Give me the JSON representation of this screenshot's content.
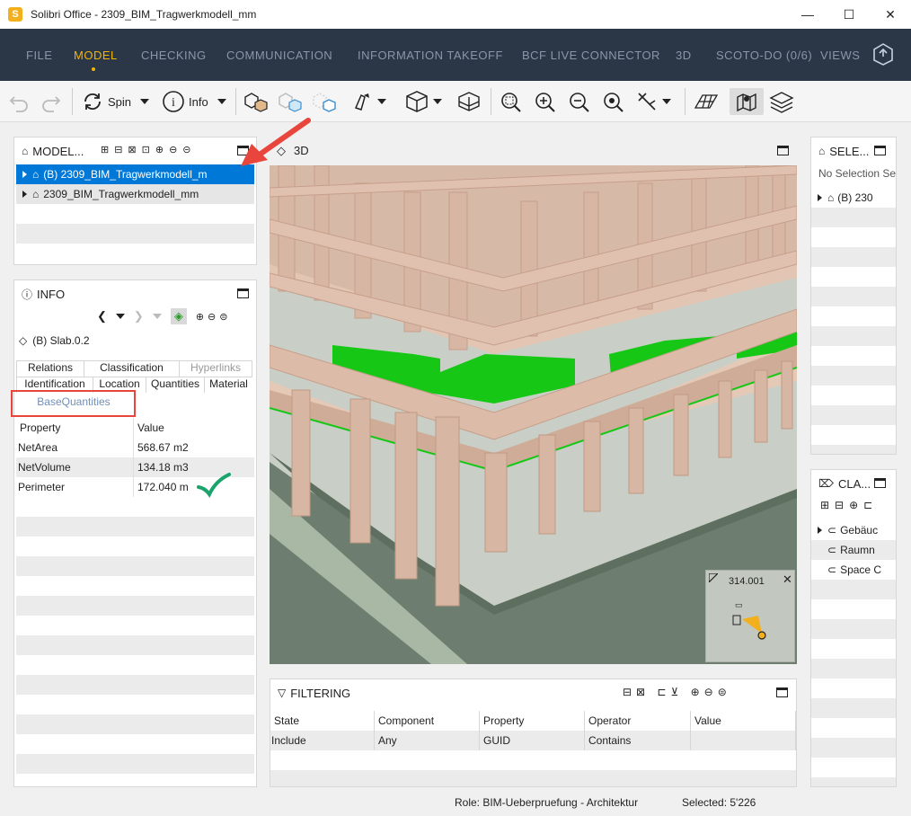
{
  "window": {
    "title": "Solibri Office - 2309_BIM_Tragwerkmodell_mm",
    "logo_letter": "S",
    "minimize": "—",
    "maximize": "☐",
    "close": "✕"
  },
  "menu": {
    "items": [
      "FILE",
      "MODEL",
      "CHECKING",
      "COMMUNICATION",
      "INFORMATION TAKEOFF",
      "BCF LIVE CONNECTOR",
      "3D",
      "SCOTO-DO (0/6)",
      "VIEWS"
    ],
    "active": "MODEL",
    "accent_color": "#f4b400"
  },
  "toolbar": {
    "spin_label": "Spin",
    "info_label": "Info"
  },
  "model_panel": {
    "title": "MODEL...",
    "rows": [
      "(B) 2309_BIM_Tragwerkmodell_m",
      "2309_BIM_Tragwerkmodell_mm"
    ]
  },
  "info_panel": {
    "title": "INFO",
    "object_name": "(B) Slab.0.2",
    "tabs_row1": [
      "Relations",
      "Classification",
      "Hyperlinks"
    ],
    "tabs_row2": [
      "Identification",
      "Location",
      "Quantities",
      "Material"
    ],
    "active_tab": "BaseQuantities",
    "headers": [
      "Property",
      "Value"
    ],
    "rows": [
      {
        "property": "NetArea",
        "value": "568.67 m2"
      },
      {
        "property": "NetVolume",
        "value": "134.18 m3"
      },
      {
        "property": "Perimeter",
        "value": "172.040 m"
      }
    ]
  },
  "view3d": {
    "title": "3D",
    "navigator_value": "314.001"
  },
  "selection_panel": {
    "title": "SELE...",
    "empty_text": "No Selection Se",
    "rows": [
      "(B) 230"
    ]
  },
  "classification_panel": {
    "title": "CLA...",
    "rows": [
      "Gebäuc",
      "Raumn",
      "Space C"
    ]
  },
  "filtering": {
    "title": "FILTERING",
    "headers": [
      "State",
      "Component",
      "Property",
      "Operator",
      "Value"
    ],
    "row": [
      "Include",
      "Any",
      "GUID",
      "Contains",
      ""
    ]
  },
  "status": {
    "role": "Role: BIM-Ueberpruefung - Architektur",
    "selected": "Selected: 5'226"
  },
  "colors": {
    "menubar": "#2b3647",
    "selection": "#0078d7",
    "annotation_red": "#e8453c",
    "annotation_check": "#1aa36b",
    "slab_green": "#14c814"
  }
}
